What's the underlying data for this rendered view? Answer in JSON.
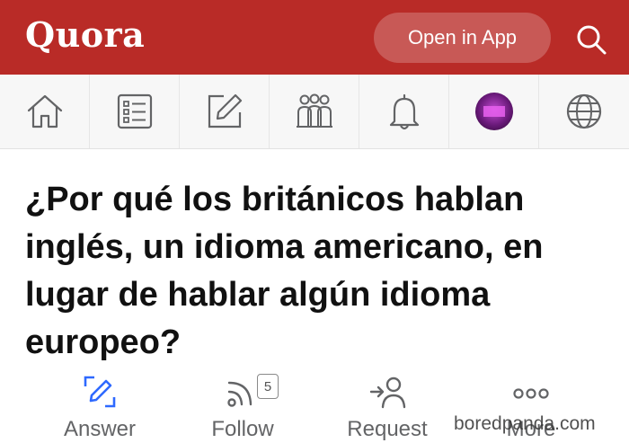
{
  "header": {
    "logo": "Quora",
    "open_app_label": "Open in App",
    "brand_color": "#b92b27"
  },
  "nav": {
    "items": [
      {
        "name": "home",
        "icon": "home-icon"
      },
      {
        "name": "answer",
        "icon": "list-icon"
      },
      {
        "name": "write",
        "icon": "edit-icon"
      },
      {
        "name": "spaces",
        "icon": "people-icon"
      },
      {
        "name": "notifications",
        "icon": "bell-icon"
      },
      {
        "name": "profile",
        "icon": "avatar"
      },
      {
        "name": "language",
        "icon": "globe-icon"
      }
    ]
  },
  "question": {
    "text": "¿Por qué los británicos hablan inglés, un idioma americano, en lugar de hablar algún idioma europeo?"
  },
  "actions": {
    "answer_label": "Answer",
    "follow_label": "Follow",
    "follow_count": "5",
    "request_label": "Request",
    "more_label": "More",
    "accent_color": "#2e69ff"
  },
  "watermark": "boredpanda.com"
}
